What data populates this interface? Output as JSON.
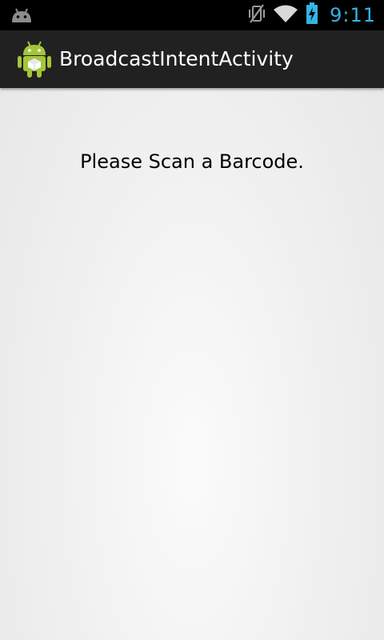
{
  "status_bar": {
    "time": "9:11",
    "icons": [
      "android-notification-icon",
      "vibrate-mute-icon",
      "wifi-icon",
      "battery-charging-icon"
    ],
    "time_color": "#33b5e5"
  },
  "action_bar": {
    "title": "BroadcastIntentActivity",
    "icon": "android-app-icon"
  },
  "main": {
    "message": "Please Scan a Barcode."
  }
}
